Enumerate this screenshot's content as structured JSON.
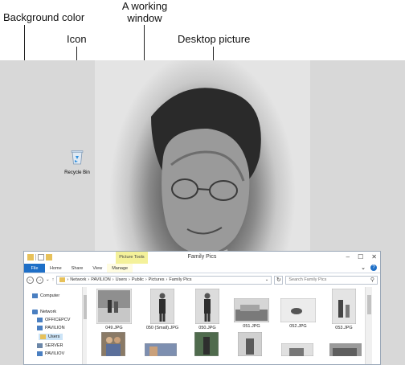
{
  "callouts": {
    "background_color": "Background color",
    "icon": "Icon",
    "working_window_line1": "A working",
    "working_window_line2": "window",
    "desktop_picture": "Desktop picture"
  },
  "desktop": {
    "background_color_hex": "#d8d8d8",
    "recycle_bin_label": "Recycle Bin"
  },
  "window": {
    "title": "Family Pics",
    "context_tab": "Picture Tools",
    "tabs": [
      "File",
      "Home",
      "Share",
      "View",
      "Manage"
    ],
    "controls": [
      "–",
      "☐",
      "✕"
    ],
    "nav_back": "←",
    "nav_forward": "→",
    "nav_up": "↑",
    "breadcrumb": [
      "Network",
      "PAVILION",
      "Users",
      "Public",
      "Pictures",
      "Family Pics"
    ],
    "search_placeholder": "Search Family Pics",
    "nav_pane": {
      "computer": "Computer",
      "network": "Network",
      "officepcv": "OFFICEPCV",
      "pavilion": "PAVILION",
      "users": "Users",
      "server": "SERVER",
      "partial": "PAVILIOV"
    },
    "files": [
      "049.JPG",
      "050 (Small).JPG",
      "050.JPG",
      "051.JPG",
      "052.JPG",
      "053.JPG"
    ],
    "accent_color": "#1e6fc7",
    "context_tab_color": "#f4f19a"
  }
}
